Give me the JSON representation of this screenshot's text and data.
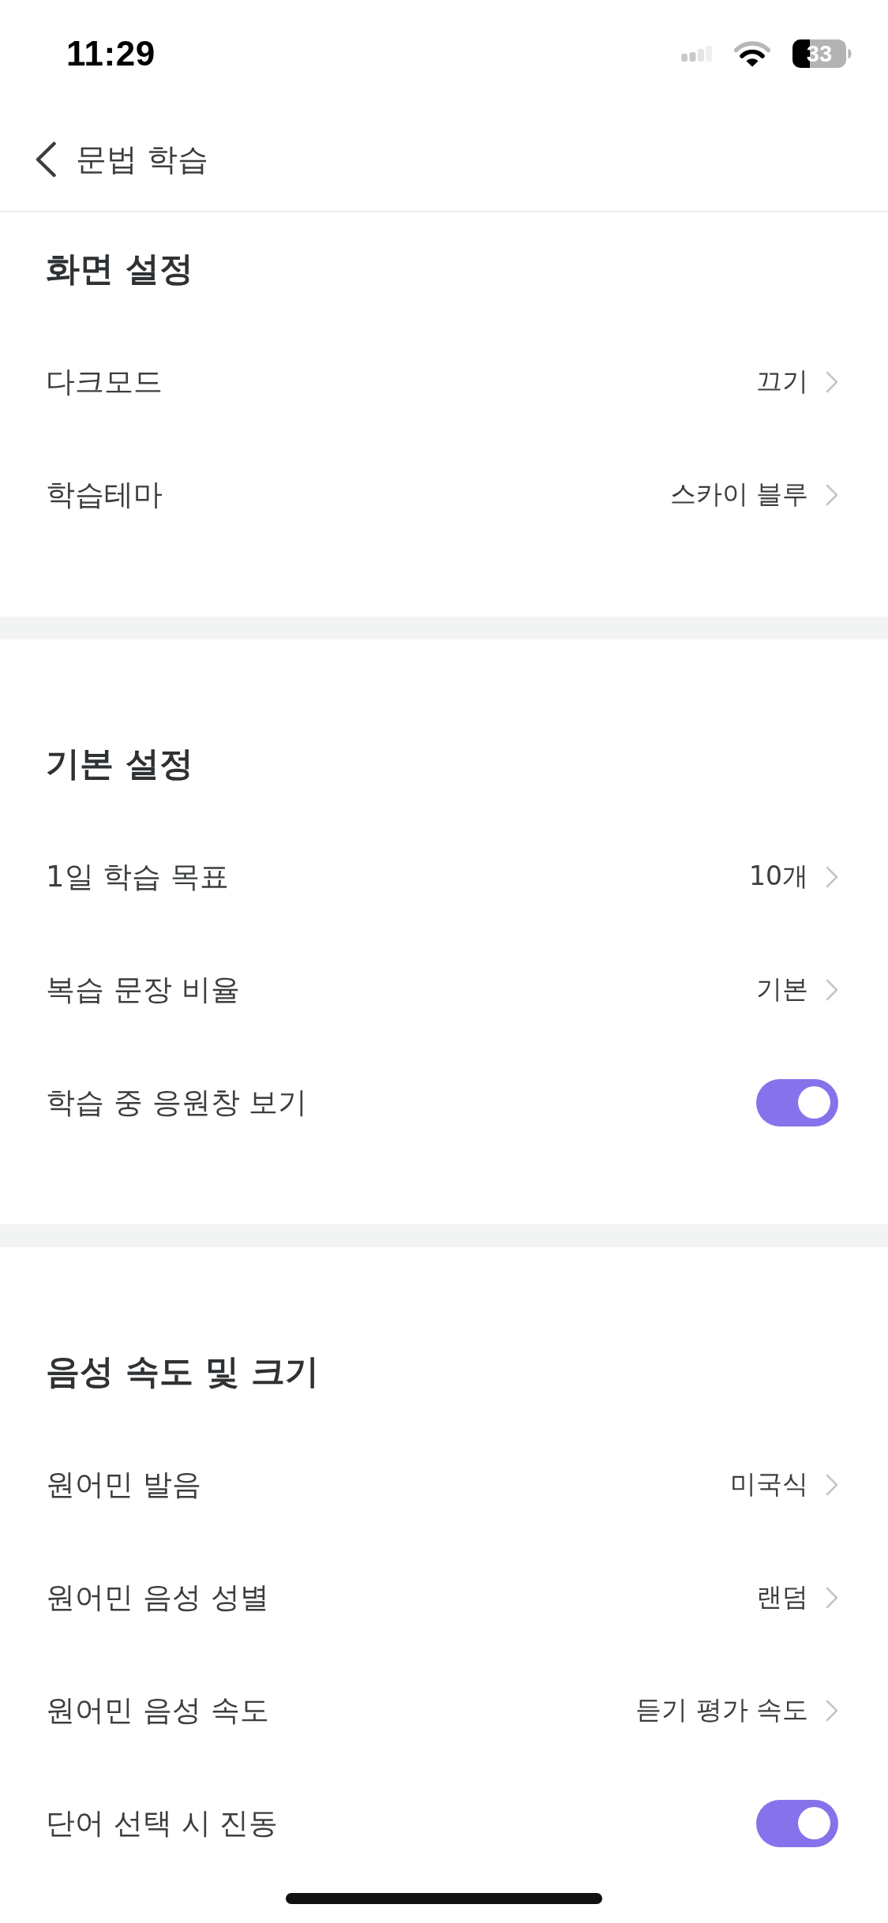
{
  "status_bar": {
    "time": "11:29",
    "battery": "33"
  },
  "nav": {
    "title": "문법 학습"
  },
  "sections": [
    {
      "title": "화면 설정",
      "items": [
        {
          "kind": "link",
          "label": "다크모드",
          "value": "끄기"
        },
        {
          "kind": "link",
          "label": "학습테마",
          "value": "스카이 블루"
        }
      ]
    },
    {
      "title": "기본 설정",
      "items": [
        {
          "kind": "link",
          "label": "1일 학습 목표",
          "value": "10개"
        },
        {
          "kind": "link",
          "label": "복습 문장 비율",
          "value": "기본"
        },
        {
          "kind": "toggle",
          "label": "학습 중 응원창 보기",
          "on": true
        }
      ]
    },
    {
      "title": "음성 속도 및 크기",
      "items": [
        {
          "kind": "link",
          "label": "원어민 발음",
          "value": "미국식"
        },
        {
          "kind": "link",
          "label": "원어민 음성 성별",
          "value": "랜덤"
        },
        {
          "kind": "link",
          "label": "원어민 음성 속도",
          "value": "듣기 평가 속도"
        },
        {
          "kind": "toggle",
          "label": "단어 선택 시 진동",
          "on": true
        }
      ]
    }
  ]
}
